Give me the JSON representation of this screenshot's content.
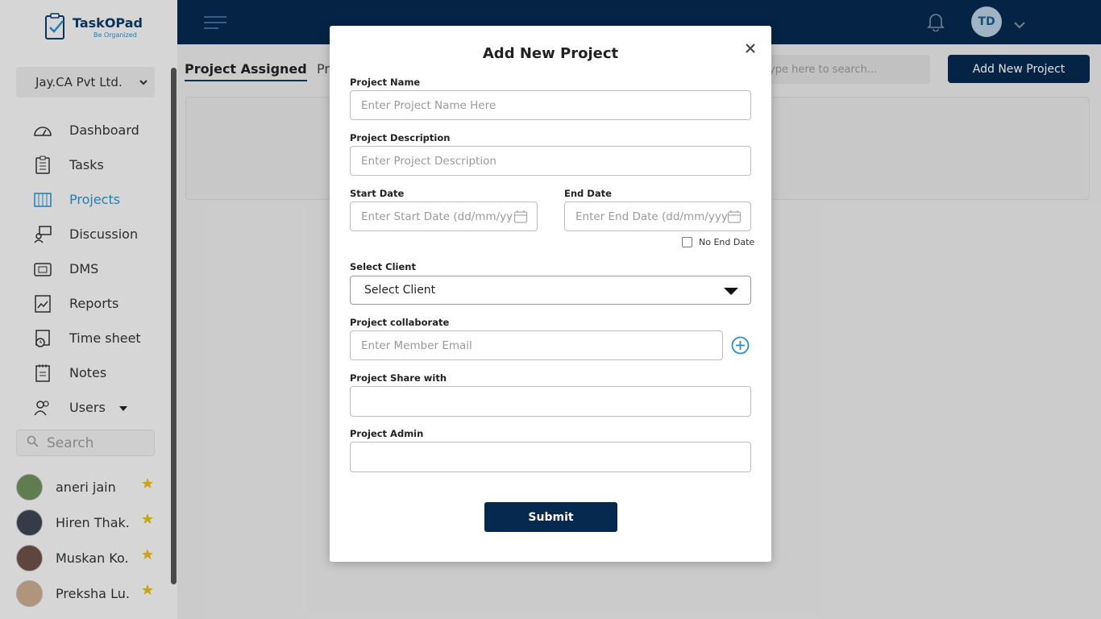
{
  "app": {
    "brand": "TaskOPad",
    "tagline": "Be Organized"
  },
  "sidebar": {
    "organization": "Jay.CA Pvt Ltd.",
    "nav": [
      {
        "label": "Dashboard",
        "icon": "dashboard-icon",
        "active": false
      },
      {
        "label": "Tasks",
        "icon": "tasks-icon",
        "active": false
      },
      {
        "label": "Projects",
        "icon": "projects-icon",
        "active": true
      },
      {
        "label": "Discussion",
        "icon": "discussion-icon",
        "active": false
      },
      {
        "label": "DMS",
        "icon": "dms-icon",
        "active": false
      },
      {
        "label": "Reports",
        "icon": "reports-icon",
        "active": false
      },
      {
        "label": "Time sheet",
        "icon": "timesheet-icon",
        "active": false
      },
      {
        "label": "Notes",
        "icon": "notes-icon",
        "active": false
      },
      {
        "label": "Users",
        "icon": "users-icon",
        "active": false
      }
    ],
    "search_placeholder": "Search",
    "users": [
      {
        "name": "aneri jain"
      },
      {
        "name": "Hiren Thak..."
      },
      {
        "name": "Muskan Ko..."
      },
      {
        "name": "Preksha Lu..."
      }
    ]
  },
  "header": {
    "avatar_initials": "TD"
  },
  "main": {
    "tabs": [
      {
        "label": "Project Assigned",
        "active": true
      },
      {
        "label": "Pr",
        "active": false
      }
    ],
    "search_placeholder": "ype here to search...",
    "add_button": "Add New Project"
  },
  "modal": {
    "title": "Add New Project",
    "project_name": {
      "label": "Project Name",
      "placeholder": "Enter Project Name Here"
    },
    "project_description": {
      "label": "Project Description",
      "placeholder": "Enter Project Description"
    },
    "start_date": {
      "label": "Start Date",
      "placeholder": "Enter Start Date (dd/mm/yy"
    },
    "end_date": {
      "label": "End Date",
      "placeholder": "Enter End Date (dd/mm/yyy"
    },
    "no_end_date": "No End Date",
    "select_client": {
      "label": "Select Client",
      "value": "Select Client"
    },
    "collaborate": {
      "label": "Project collaborate",
      "placeholder": "Enter Member Email"
    },
    "share_with": {
      "label": "Project Share with"
    },
    "admin": {
      "label": "Project Admin"
    },
    "submit": "Submit"
  },
  "colors": {
    "navy": "#062a4f",
    "accent": "#2a8fd0",
    "star": "#e8b923"
  }
}
